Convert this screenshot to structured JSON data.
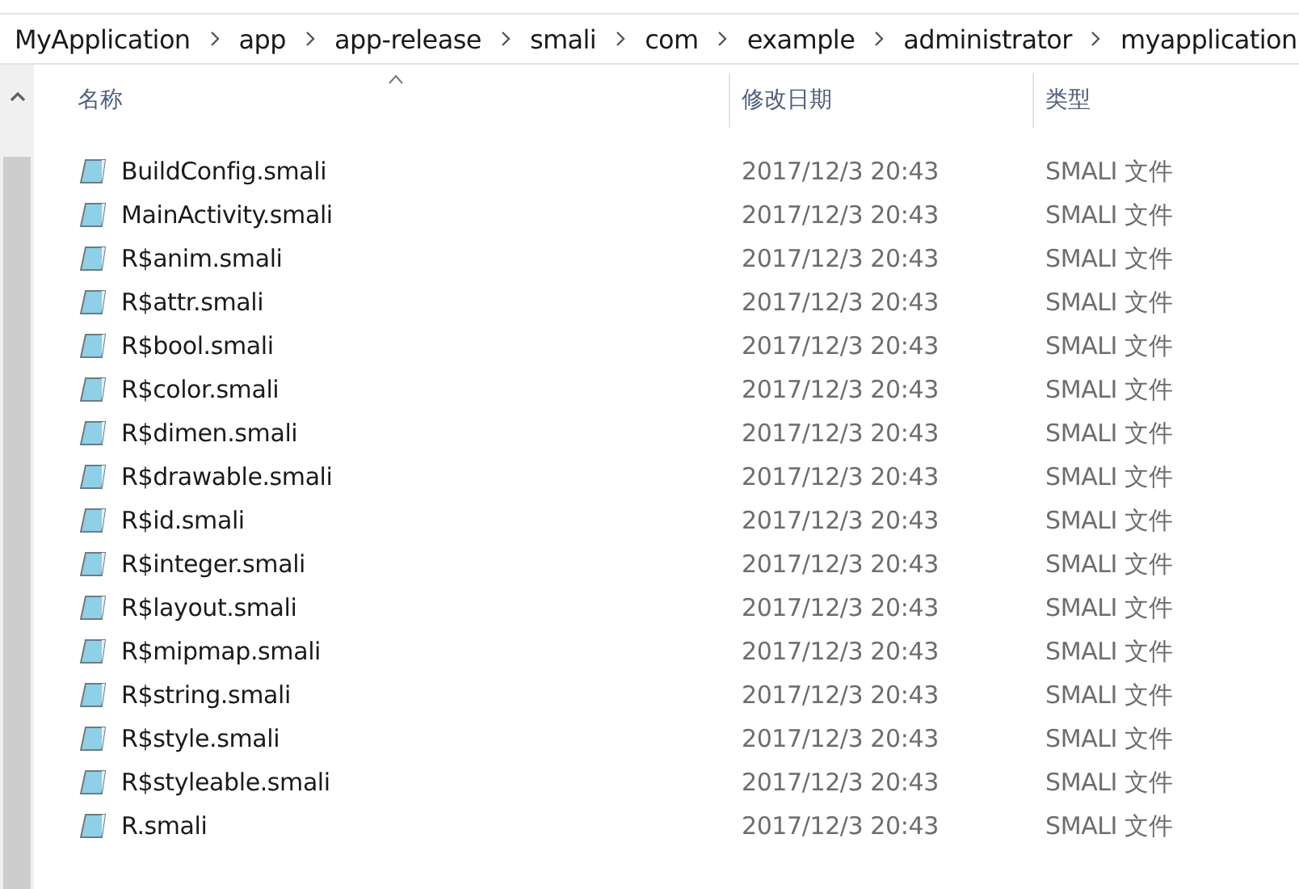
{
  "breadcrumb": [
    "MyApplication",
    "app",
    "app-release",
    "smali",
    "com",
    "example",
    "administrator",
    "myapplication"
  ],
  "columns": [
    {
      "label": "名称",
      "sorted": true
    },
    {
      "label": "修改日期",
      "sorted": false
    },
    {
      "label": "类型",
      "sorted": false
    }
  ],
  "files": [
    {
      "name": "BuildConfig.smali",
      "date": "2017/12/3 20:43",
      "type": "SMALI 文件"
    },
    {
      "name": "MainActivity.smali",
      "date": "2017/12/3 20:43",
      "type": "SMALI 文件"
    },
    {
      "name": "R$anim.smali",
      "date": "2017/12/3 20:43",
      "type": "SMALI 文件"
    },
    {
      "name": "R$attr.smali",
      "date": "2017/12/3 20:43",
      "type": "SMALI 文件"
    },
    {
      "name": "R$bool.smali",
      "date": "2017/12/3 20:43",
      "type": "SMALI 文件"
    },
    {
      "name": "R$color.smali",
      "date": "2017/12/3 20:43",
      "type": "SMALI 文件"
    },
    {
      "name": "R$dimen.smali",
      "date": "2017/12/3 20:43",
      "type": "SMALI 文件"
    },
    {
      "name": "R$drawable.smali",
      "date": "2017/12/3 20:43",
      "type": "SMALI 文件"
    },
    {
      "name": "R$id.smali",
      "date": "2017/12/3 20:43",
      "type": "SMALI 文件"
    },
    {
      "name": "R$integer.smali",
      "date": "2017/12/3 20:43",
      "type": "SMALI 文件"
    },
    {
      "name": "R$layout.smali",
      "date": "2017/12/3 20:43",
      "type": "SMALI 文件"
    },
    {
      "name": "R$mipmap.smali",
      "date": "2017/12/3 20:43",
      "type": "SMALI 文件"
    },
    {
      "name": "R$string.smali",
      "date": "2017/12/3 20:43",
      "type": "SMALI 文件"
    },
    {
      "name": "R$style.smali",
      "date": "2017/12/3 20:43",
      "type": "SMALI 文件"
    },
    {
      "name": "R$styleable.smali",
      "date": "2017/12/3 20:43",
      "type": "SMALI 文件"
    },
    {
      "name": "R.smali",
      "date": "2017/12/3 20:43",
      "type": "SMALI 文件"
    }
  ]
}
